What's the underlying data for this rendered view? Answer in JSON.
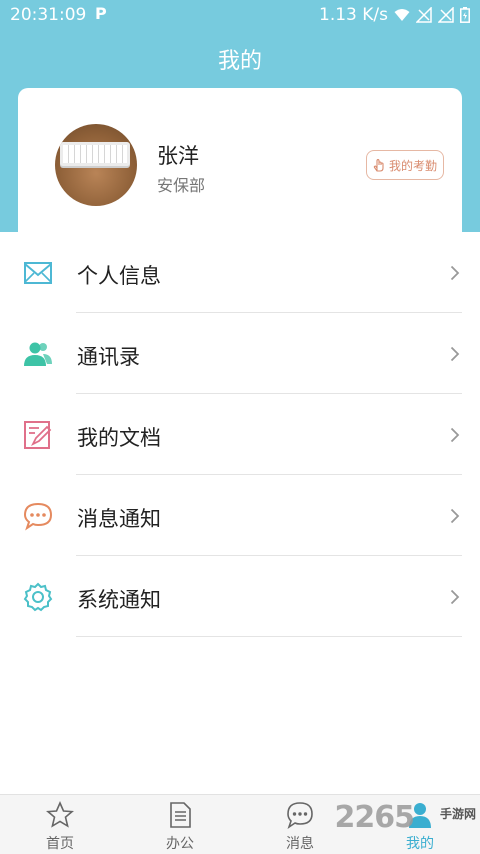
{
  "status_bar": {
    "time": "20:31:09",
    "indicator": "P",
    "net_speed": "1.13 K/s"
  },
  "page": {
    "title": "我的"
  },
  "profile": {
    "name": "张洋",
    "department": "安保部",
    "attendance_label": "我的考勤"
  },
  "menu": {
    "items": [
      {
        "label": "个人信息",
        "icon": "envelope-icon",
        "color": "#4db8d4"
      },
      {
        "label": "通讯录",
        "icon": "contacts-icon",
        "color": "#3dc3a6"
      },
      {
        "label": "我的文档",
        "icon": "document-edit-icon",
        "color": "#e0708a"
      },
      {
        "label": "消息通知",
        "icon": "chat-bubble-icon",
        "color": "#e58a5f"
      },
      {
        "label": "系统通知",
        "icon": "gear-icon",
        "color": "#4bc0c8"
      }
    ]
  },
  "tabs": [
    {
      "label": "首页",
      "icon": "star-icon"
    },
    {
      "label": "办公",
      "icon": "document-icon"
    },
    {
      "label": "消息",
      "icon": "chat-icon"
    },
    {
      "label": "我的",
      "icon": "person-icon",
      "active": true
    }
  ],
  "watermark": {
    "text": "2265",
    "sub": "手游网"
  },
  "colors": {
    "header": "#77cbde",
    "active_tab": "#3aaed0"
  }
}
